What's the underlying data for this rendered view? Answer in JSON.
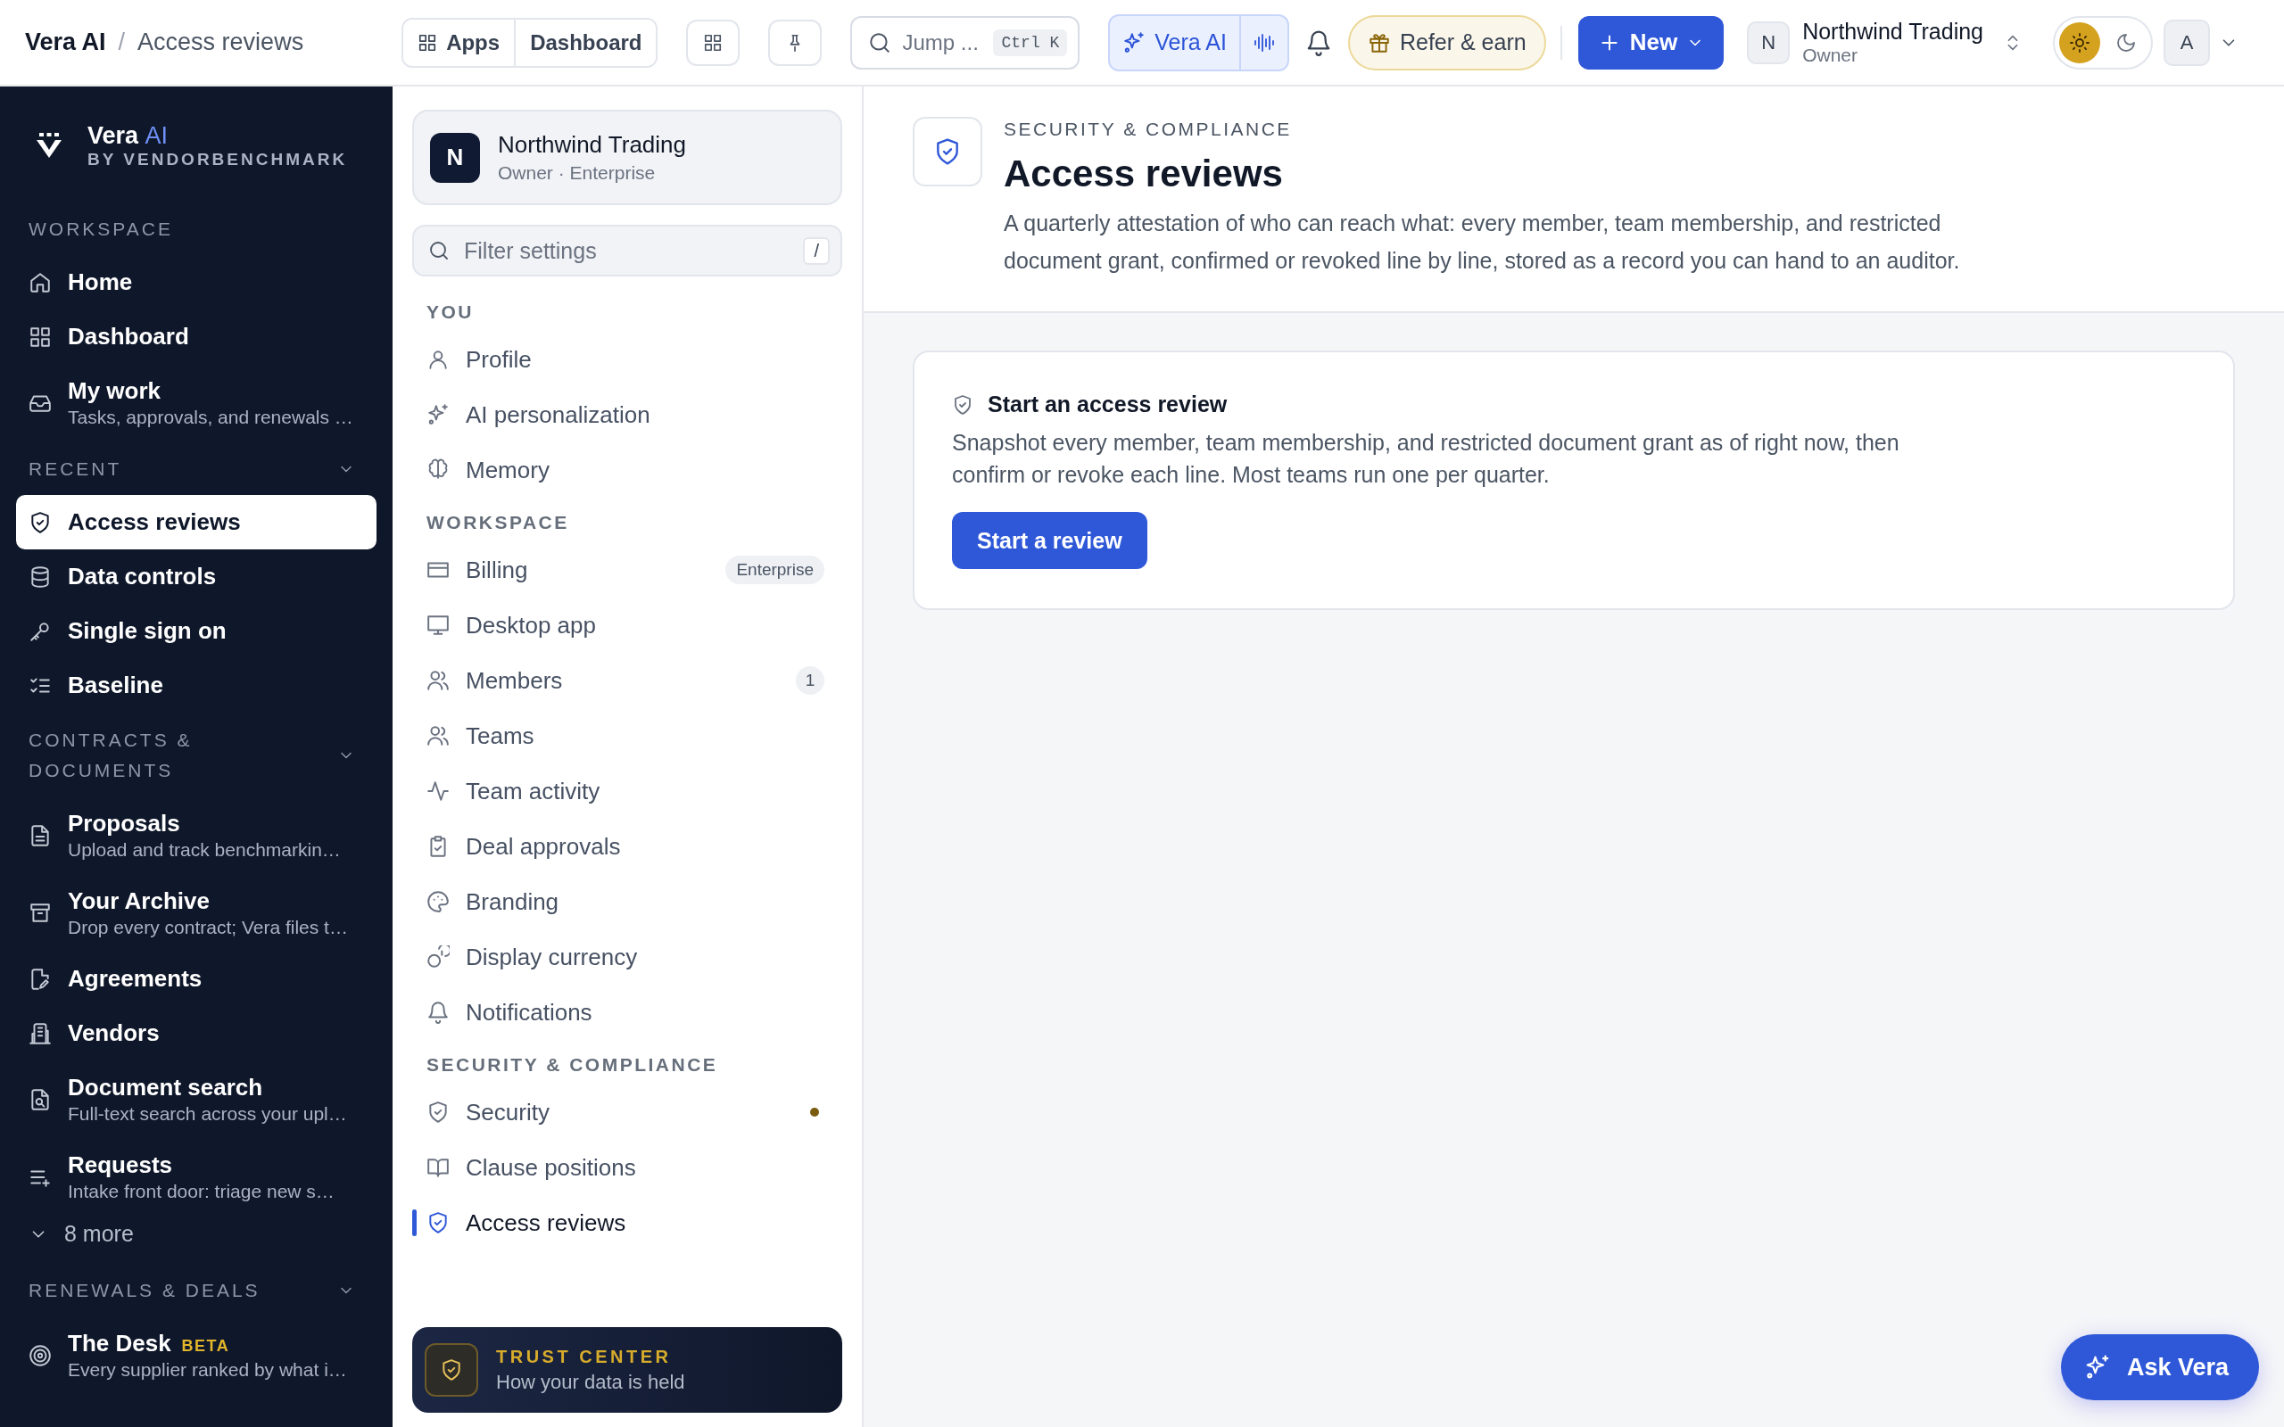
{
  "breadcrumb": {
    "app": "Vera AI",
    "separator": "/",
    "page": "Access reviews"
  },
  "top_bar": {
    "apps_button": "Apps",
    "dashboard_button": "Dashboard",
    "search": {
      "placeholder": "Jump ...",
      "shortcut": "Ctrl K"
    },
    "assistant_button": "Vera AI",
    "refer_button": "Refer & earn",
    "new_button": "New",
    "workspace": {
      "initial": "N",
      "name": "Northwind Trading",
      "role": "Owner"
    },
    "theme_options": [
      {
        "selected": true
      },
      {
        "selected": false
      }
    ],
    "avatar": "A"
  },
  "sidebar": {
    "brand": {
      "name": "Vera",
      "accent": "AI",
      "tagline": "BY VENDORBENCHMARK"
    },
    "sections": [
      {
        "title": "WORKSPACE",
        "collapsible": false,
        "items": [
          {
            "label": "Home",
            "selected": false
          },
          {
            "label": "Dashboard",
            "selected": false
          },
          {
            "label": "My work",
            "description": "Tasks, approvals, and renewals …",
            "selected": false
          }
        ]
      },
      {
        "title": "RECENT",
        "collapsible": true,
        "items": [
          {
            "label": "Access reviews",
            "selected": true
          },
          {
            "label": "Data controls",
            "selected": false
          },
          {
            "label": "Single sign on",
            "selected": false
          },
          {
            "label": "Baseline",
            "selected": false
          }
        ]
      },
      {
        "title": "CONTRACTS & DOCUMENTS",
        "collapsible": true,
        "more": "8 more",
        "items": [
          {
            "label": "Proposals",
            "description": "Upload and track benchmarkin…",
            "selected": false
          },
          {
            "label": "Your Archive",
            "description": "Drop every contract; Vera files t…",
            "selected": false
          },
          {
            "label": "Agreements",
            "selected": false
          },
          {
            "label": "Vendors",
            "selected": false
          },
          {
            "label": "Document search",
            "description": "Full-text search across your upl…",
            "selected": false
          },
          {
            "label": "Requests",
            "description": "Intake front door: triage new s…",
            "selected": false
          }
        ]
      },
      {
        "title": "RENEWALS & DEALS",
        "collapsible": true,
        "items": [
          {
            "label": "The Desk",
            "badge": "BETA",
            "description": "Every supplier ranked by what i…",
            "selected": false
          }
        ]
      }
    ]
  },
  "settings": {
    "org": {
      "initial": "N",
      "name": "Northwind Trading",
      "subtitle": "Owner · Enterprise"
    },
    "filter": {
      "placeholder": "Filter settings",
      "shortcut": "/"
    },
    "groups": [
      {
        "title": "YOU",
        "items": [
          {
            "label": "Profile",
            "selected": false,
            "dot": false
          },
          {
            "label": "AI personalization",
            "selected": false,
            "dot": false
          },
          {
            "label": "Memory",
            "selected": false,
            "dot": false
          }
        ]
      },
      {
        "title": "WORKSPACE",
        "items": [
          {
            "label": "Billing",
            "badge": "Enterprise",
            "selected": false,
            "dot": false
          },
          {
            "label": "Desktop app",
            "selected": false,
            "dot": false
          },
          {
            "label": "Members",
            "badge": "1",
            "selected": false,
            "dot": false
          },
          {
            "label": "Teams",
            "selected": false,
            "dot": false
          },
          {
            "label": "Team activity",
            "selected": false,
            "dot": false
          },
          {
            "label": "Deal approvals",
            "selected": false,
            "dot": false
          },
          {
            "label": "Branding",
            "selected": false,
            "dot": false
          },
          {
            "label": "Display currency",
            "selected": false,
            "dot": false
          },
          {
            "label": "Notifications",
            "selected": false,
            "dot": false
          }
        ]
      },
      {
        "title": "SECURITY & COMPLIANCE",
        "items": [
          {
            "label": "Security",
            "selected": false,
            "dot": true
          },
          {
            "label": "Clause positions",
            "selected": false,
            "dot": false
          },
          {
            "label": "Access reviews",
            "selected": true,
            "dot": false
          }
        ]
      }
    ],
    "trust_center": {
      "title": "TRUST CENTER",
      "subtitle": "How your data is held"
    }
  },
  "page": {
    "eyebrow": "SECURITY & COMPLIANCE",
    "title": "Access reviews",
    "description": "A quarterly attestation of who can reach what: every member, team membership, and restricted document grant, confirmed or revoked line by line, stored as a record you can hand to an auditor."
  },
  "card": {
    "title": "Start an access review",
    "text": "Snapshot every member, team membership, and restricted document grant as of right now, then confirm or revoke each line. Most teams run one per quarter.",
    "button": "Start a review"
  },
  "ask_button": "Ask Vera"
}
